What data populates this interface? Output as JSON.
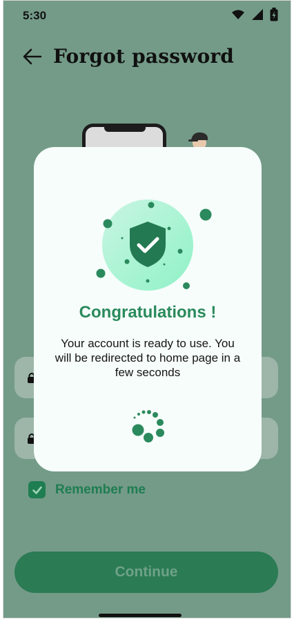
{
  "status_bar": {
    "time": "5:30",
    "icons": [
      "wifi-icon",
      "signal-icon",
      "battery-charging-icon"
    ]
  },
  "header": {
    "title": "Forgot password",
    "back_icon": "arrow-left-icon"
  },
  "form": {
    "password_icon": "lock-icon",
    "remember_me_label": "Remember me",
    "remember_me_checked": true
  },
  "continue_button": {
    "label": "Continue"
  },
  "modal": {
    "badge_icon": "shield-check-icon",
    "title": "Congratulations !",
    "message": "Your account is ready to use. You will be redirected to home page in a few seconds",
    "loading_icon": "spinner-icon"
  },
  "colors": {
    "accent": "#2b8a5d",
    "overlay_background": "#749b88",
    "modal_background": "#f6fdfb",
    "badge_gradient_start": "#c9f5e3",
    "badge_gradient_end": "#8ff2c6"
  }
}
